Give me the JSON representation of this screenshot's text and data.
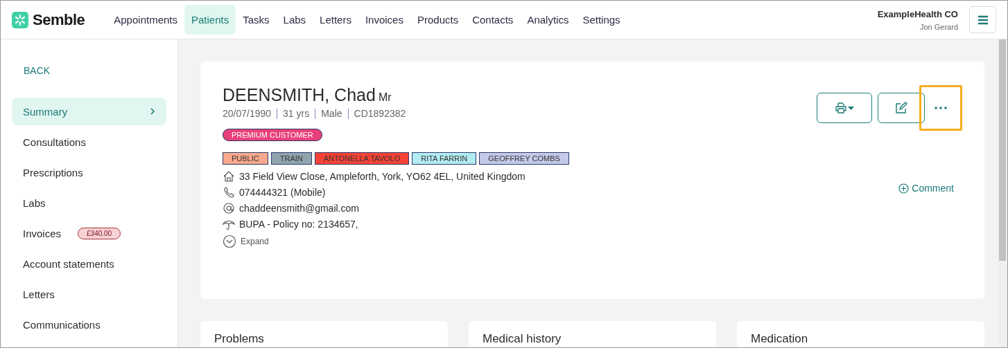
{
  "logo": {
    "text": "Semble"
  },
  "nav": [
    {
      "label": "Appointments",
      "selected": false
    },
    {
      "label": "Patients",
      "selected": true
    },
    {
      "label": "Tasks",
      "selected": false
    },
    {
      "label": "Labs",
      "selected": false
    },
    {
      "label": "Letters",
      "selected": false
    },
    {
      "label": "Invoices",
      "selected": false
    },
    {
      "label": "Products",
      "selected": false
    },
    {
      "label": "Contacts",
      "selected": false
    },
    {
      "label": "Analytics",
      "selected": false
    },
    {
      "label": "Settings",
      "selected": false
    }
  ],
  "account": {
    "organisation": "ExampleHealth CO",
    "user": "Jon Gerard"
  },
  "sidebar": {
    "back": "BACK",
    "items": [
      {
        "label": "Summary",
        "selected": true
      },
      {
        "label": "Consultations",
        "selected": false
      },
      {
        "label": "Prescriptions",
        "selected": false
      },
      {
        "label": "Labs",
        "selected": false
      },
      {
        "label": "Invoices",
        "selected": false,
        "badge": "£340.00"
      },
      {
        "label": "Account statements",
        "selected": false
      },
      {
        "label": "Letters",
        "selected": false
      },
      {
        "label": "Communications",
        "selected": false
      }
    ]
  },
  "patient": {
    "name": "DEENSMITH, Chad",
    "title": "Mr",
    "details": [
      "20/07/1990",
      "31 yrs",
      "Male",
      "CD1892382"
    ],
    "status_badge": "PREMIUM CUSTOMER",
    "tags": [
      {
        "label": "PUBLIC",
        "color": "#f9a98b"
      },
      {
        "label": "TRAIN",
        "color": "#90a4ae"
      },
      {
        "label": "ANTONELLA TAVOLO",
        "color": "#f44336"
      },
      {
        "label": "RITA FARRIN",
        "color": "#b2ebf2"
      },
      {
        "label": "GEOFFREY COMBS",
        "color": "#c5cae9"
      }
    ],
    "contacts": [
      {
        "kind": "address",
        "text": "33 Field View Close, Ampleforth, York, YO62 4EL, United Kingdom"
      },
      {
        "kind": "phone",
        "text": "074444321 (Mobile)"
      },
      {
        "kind": "email",
        "text": "chaddeensmith@gmail.com"
      },
      {
        "kind": "insurance",
        "text": "BUPA - Policy no: 2134657,"
      }
    ],
    "expand": "Expand",
    "comment": "Comment",
    "more_highlighted": true
  },
  "panels": [
    {
      "title": "Problems"
    },
    {
      "title": "Medical history"
    },
    {
      "title": "Medication"
    }
  ]
}
